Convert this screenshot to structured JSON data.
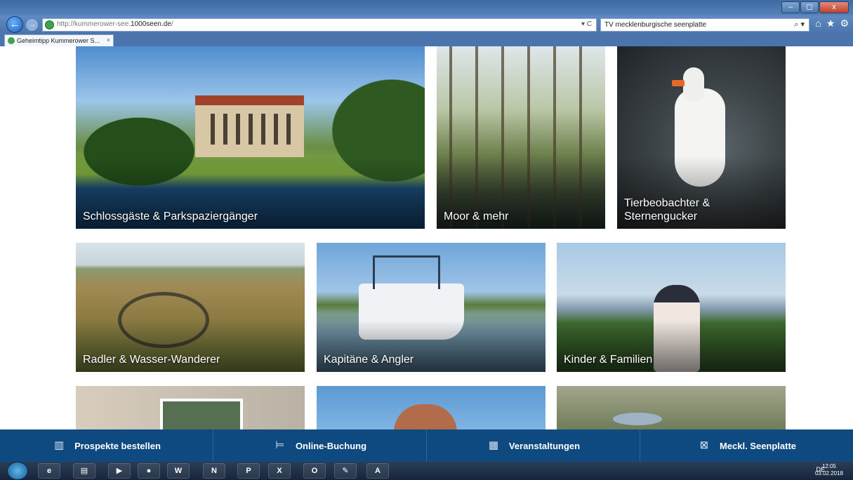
{
  "browser": {
    "url_prefix": "http://kummerower-see.",
    "url_domain": "1000seen.de",
    "url_suffix": "/",
    "search_value": "TV mecklenburgische seenplatte",
    "tab_title": "Geheimtipp Kummerower S...",
    "tab_close": "×",
    "back": "←",
    "forward": "→",
    "addr_controls": "▾ C",
    "search_glyph": "⌕ ▾",
    "tools": [
      "⌂",
      "★",
      "⚙"
    ],
    "window_controls": [
      "–",
      "◻",
      "x"
    ]
  },
  "tiles": [
    {
      "caption": "Schlossgäste & Parkspaziergänger"
    },
    {
      "caption": "Moor & mehr"
    },
    {
      "caption": "Tierbeobachter & Sternengucker"
    },
    {
      "caption": "Radler & Wasser-Wanderer"
    },
    {
      "caption": "Kapitäne & Angler"
    },
    {
      "caption": "Kinder & Familien"
    }
  ],
  "bottom_nav": [
    {
      "label": "Prospekte bestellen",
      "icon": "brochure-icon",
      "glyph": "▥"
    },
    {
      "label": "Online-Buchung",
      "icon": "bed-icon",
      "glyph": "⊨"
    },
    {
      "label": "Veranstaltungen",
      "icon": "calendar-icon",
      "glyph": "▦"
    },
    {
      "label": "Meckl. Seenplatte",
      "icon": "close-box-icon",
      "glyph": "⊠"
    }
  ],
  "taskbar": {
    "apps": [
      {
        "name": "ie",
        "glyph": "e"
      },
      {
        "name": "explorer",
        "glyph": "▤"
      },
      {
        "name": "media",
        "glyph": "▶"
      },
      {
        "name": "firefox",
        "glyph": "●"
      },
      {
        "name": "word",
        "glyph": "W"
      },
      {
        "name": "onenote",
        "glyph": "N"
      },
      {
        "name": "powerpoint",
        "glyph": "P"
      },
      {
        "name": "excel",
        "glyph": "X"
      },
      {
        "name": "outlook",
        "glyph": "O"
      },
      {
        "name": "paint",
        "glyph": "✎"
      },
      {
        "name": "acrobat",
        "glyph": "A"
      }
    ],
    "lang": "DE",
    "time": "12:05",
    "date": "03.02.2018"
  }
}
